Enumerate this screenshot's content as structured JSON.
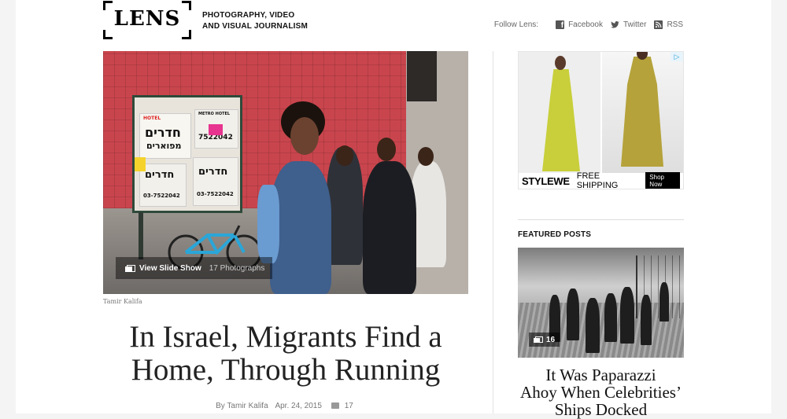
{
  "header": {
    "logo_text": "LENS",
    "tagline_line1": "Photography, Video",
    "tagline_line2": "and Visual Journalism",
    "follow_label": "Follow Lens:",
    "follow_links": [
      {
        "label": "Facebook",
        "icon": "facebook-icon"
      },
      {
        "label": "Twitter",
        "icon": "twitter-icon"
      },
      {
        "label": "RSS",
        "icon": "rss-icon"
      }
    ]
  },
  "hero": {
    "slideshow_label": "View Slide Show",
    "photo_count": "17 Photographs",
    "credit": "Tamir Kalifa",
    "poster_text": {
      "hotel": "HOTEL",
      "metro": "METRO HOTEL",
      "phone": "7522042",
      "phone2": "03-7522042"
    }
  },
  "article": {
    "title_line1": "In Israel, Migrants Find a",
    "title_line2": "Home, Through Running",
    "author": "By Tamir Kalifa",
    "date": "Apr. 24, 2015",
    "comments": "17"
  },
  "ad": {
    "brand": "STYLEWE",
    "promo": "FREE SHIPPING",
    "cta": "Shop Now",
    "adchoices_icon": "adchoices-icon"
  },
  "sidebar": {
    "featured_label": "FEATURED POSTS",
    "featured": {
      "photo_count": "16",
      "title_line1": "It Was Paparazzi",
      "title_line2": "Ahoy When Celebrities’",
      "title_line3": "Ships Docked"
    }
  },
  "colors": {
    "wall_red": "#c9454d",
    "ad_dress_green": "#c8cf3a",
    "ad_dress_mustard": "#b5a23a",
    "text_dark": "#222222"
  }
}
